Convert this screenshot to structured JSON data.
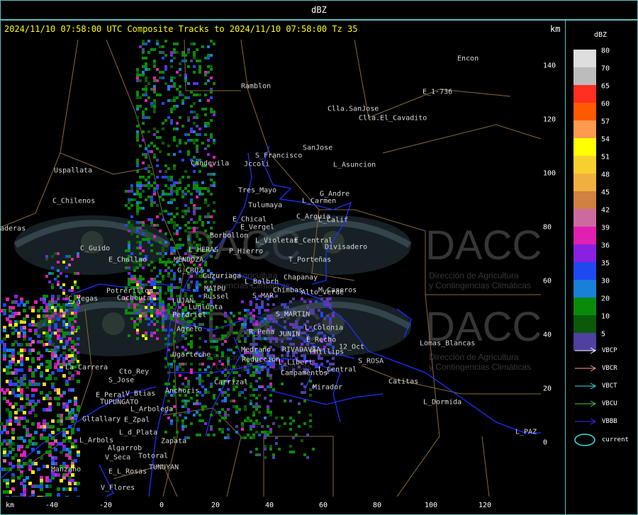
{
  "title": "dBZ",
  "header": "2024/11/10 07:58:00 UTC Composite Tracks to 2024/11/10 07:58:00 Tz 35",
  "units": {
    "corner": "km",
    "bottom": "km"
  },
  "y_ticks": [
    "140",
    "120",
    "100",
    "80",
    "60",
    "40",
    "20",
    "0"
  ],
  "x_ticks": [
    "-40",
    "-20",
    "0",
    "20",
    "40",
    "60",
    "80",
    "100",
    "120"
  ],
  "watermark": "DACC",
  "watermark_sub": [
    "Dirección de Agricultura",
    "y Contingencias Climáticas"
  ],
  "places": [
    "Ramblon",
    "Encon",
    "E_1-736",
    "Clla.SanJose",
    "Clla.El_Cavadito",
    "S_Francisco",
    "Uspallata",
    "Jccoli",
    "SanJose",
    "L_Asuncion",
    "Potrerillos",
    "Candevila",
    "Tres_Mayo",
    "G_Andre",
    "C_Chilenos",
    "Tulumaya",
    "L_Carmen",
    "E_Chical",
    "C_Arguia",
    "E_Vergel",
    "L_Calif",
    "C_Guido",
    "Borbollon",
    "E_Central",
    "E_Challao",
    "L_HERAS",
    "P_Hierro",
    "L_Violetas",
    "Divisadero",
    "MENDOZA",
    "T_Porteñas",
    "G_CRUZ",
    "Guzuriaga",
    "Chapanay",
    "C_Vegas",
    "L_Balbrh",
    "Cacheuta",
    "MAIPU",
    "Chimbas",
    "M_Caseros",
    "LUJAN",
    "Russel",
    "S_MAR",
    "Lunlunta",
    "Alto_Verde",
    "S_MARTIN",
    "Perdriel",
    "Reducción",
    "L_Libert",
    "E_Recho",
    "Agrelo",
    "R_Peña",
    "JUNIN",
    "L_Colonia",
    "Ugarteche",
    "Medrano",
    "RIVADAVIA",
    "Phillips",
    "12_Oct",
    "Lomas_Blancas",
    "L_Central",
    "S_ROSA",
    "La_Carrera",
    "Campamentos",
    "Cto_Rey",
    "Carrizal",
    "Catitas",
    "S_Jose",
    "Mirador",
    "Anchoris",
    "E_Peral",
    "V_Btias",
    "TUPUNGATO",
    "L_Arboleda",
    "L_Dormida",
    "Gltallary",
    "E_Zpal",
    "L_PAZ",
    "L_d_Plata",
    "L_Arbols",
    "Zapata",
    "Algarrob",
    "V_Seca",
    "Totoral",
    "E_L_Rosas",
    "TUNUYAN",
    "Manzano",
    "V_Flores",
    "aderas"
  ],
  "legend": {
    "title": "dBZ",
    "levels": [
      {
        "label": "80",
        "color": "#dedede"
      },
      {
        "label": "70",
        "color": "#bcbcbc"
      },
      {
        "label": "65",
        "color": "#ff3020"
      },
      {
        "label": "60",
        "color": "#ff5a00"
      },
      {
        "label": "57",
        "color": "#ff9a50"
      },
      {
        "label": "54",
        "color": "#ffff00"
      },
      {
        "label": "51",
        "color": "#f7d030"
      },
      {
        "label": "48",
        "color": "#f0b040"
      },
      {
        "label": "45",
        "color": "#d08040"
      },
      {
        "label": "42",
        "color": "#cc6aa0"
      },
      {
        "label": "39",
        "color": "#e020b0"
      },
      {
        "label": "36",
        "color": "#8a20e0"
      },
      {
        "label": "35",
        "color": "#2048f0"
      },
      {
        "label": "30",
        "color": "#1880d8"
      },
      {
        "label": "20",
        "color": "#0a8a0a"
      },
      {
        "label": "10",
        "color": "#0a5a0a"
      },
      {
        "label": "5",
        "color": "#5040a0"
      }
    ],
    "tracks": [
      {
        "label": "VBCP",
        "color": "#ffffff"
      },
      {
        "label": "VBCR",
        "color": "#ffa080"
      },
      {
        "label": "VBCT",
        "color": "#40e0e0"
      },
      {
        "label": "VBCU",
        "color": "#40d040"
      },
      {
        "label": "VBBB",
        "color": "#3030ff"
      }
    ],
    "current_label": "current"
  }
}
